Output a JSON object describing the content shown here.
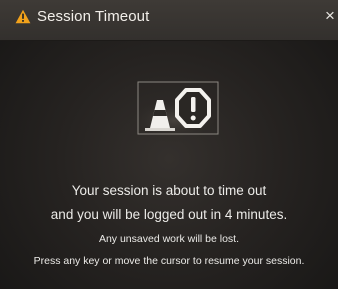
{
  "dialog": {
    "title": "Session Timeout",
    "title_icon": "warning-triangle-icon",
    "close_icon": "close-icon",
    "close_glyph": "×",
    "illustration_icons": [
      "traffic-cone-icon",
      "alert-octagon-icon"
    ],
    "message_line_1": "Your session is about to time out",
    "message_line_2": "and you will be logged out in 4 minutes.",
    "message_line_3": "Any unsaved work will be lost.",
    "message_line_4": "Press any key or move the cursor to resume your session."
  },
  "colors": {
    "warning": "#f2a21b",
    "background": "#262321",
    "title_bar": "#3b3733",
    "text": "#ecebe8"
  }
}
